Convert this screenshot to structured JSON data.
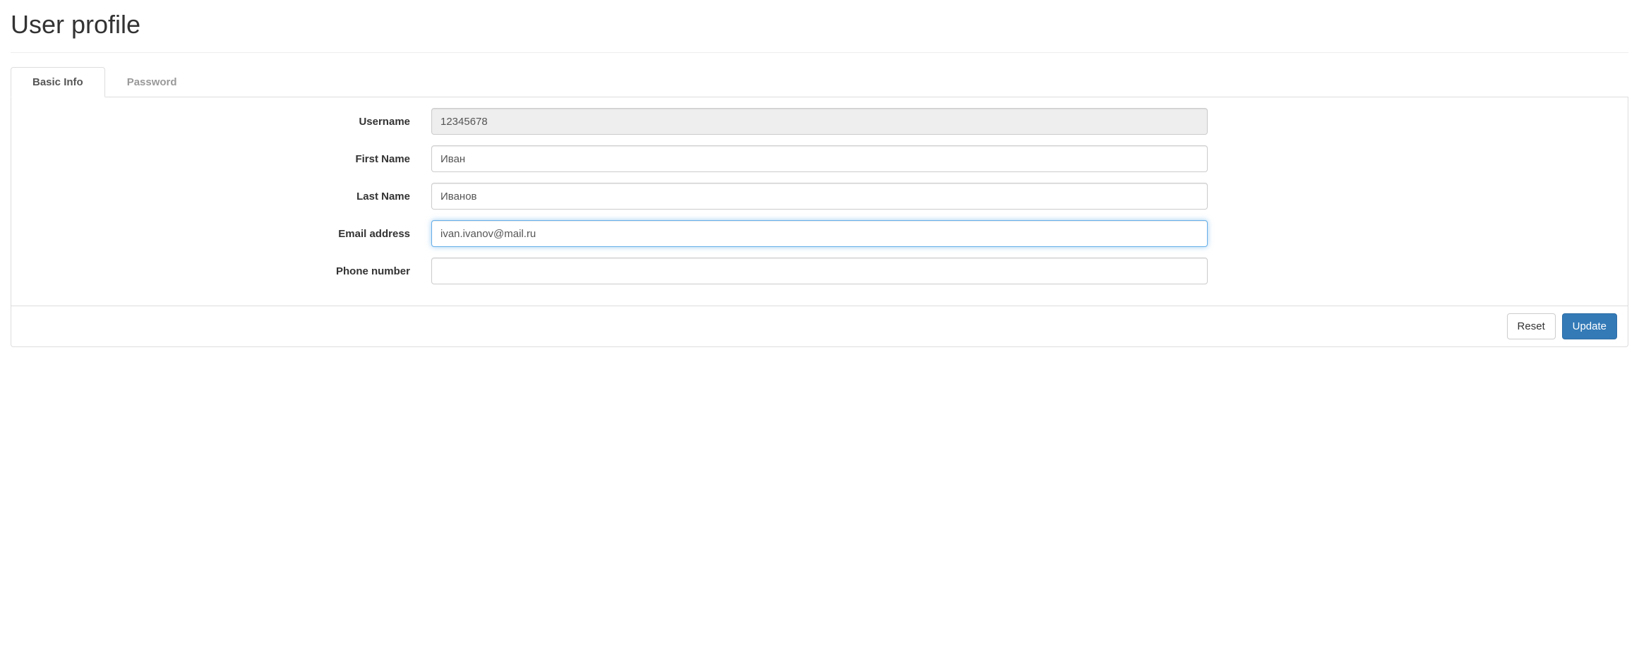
{
  "page_title": "User profile",
  "tabs": [
    {
      "label": "Basic Info",
      "active": true
    },
    {
      "label": "Password",
      "active": false
    }
  ],
  "form": {
    "username": {
      "label": "Username",
      "value": "12345678",
      "disabled": true
    },
    "first_name": {
      "label": "First Name",
      "value": "Иван",
      "disabled": false
    },
    "last_name": {
      "label": "Last Name",
      "value": "Иванов",
      "disabled": false
    },
    "email": {
      "label": "Email address",
      "value": "ivan.ivanov@mail.ru",
      "disabled": false,
      "focused": true
    },
    "phone": {
      "label": "Phone number",
      "value": "",
      "disabled": false
    }
  },
  "buttons": {
    "reset": "Reset",
    "update": "Update"
  }
}
